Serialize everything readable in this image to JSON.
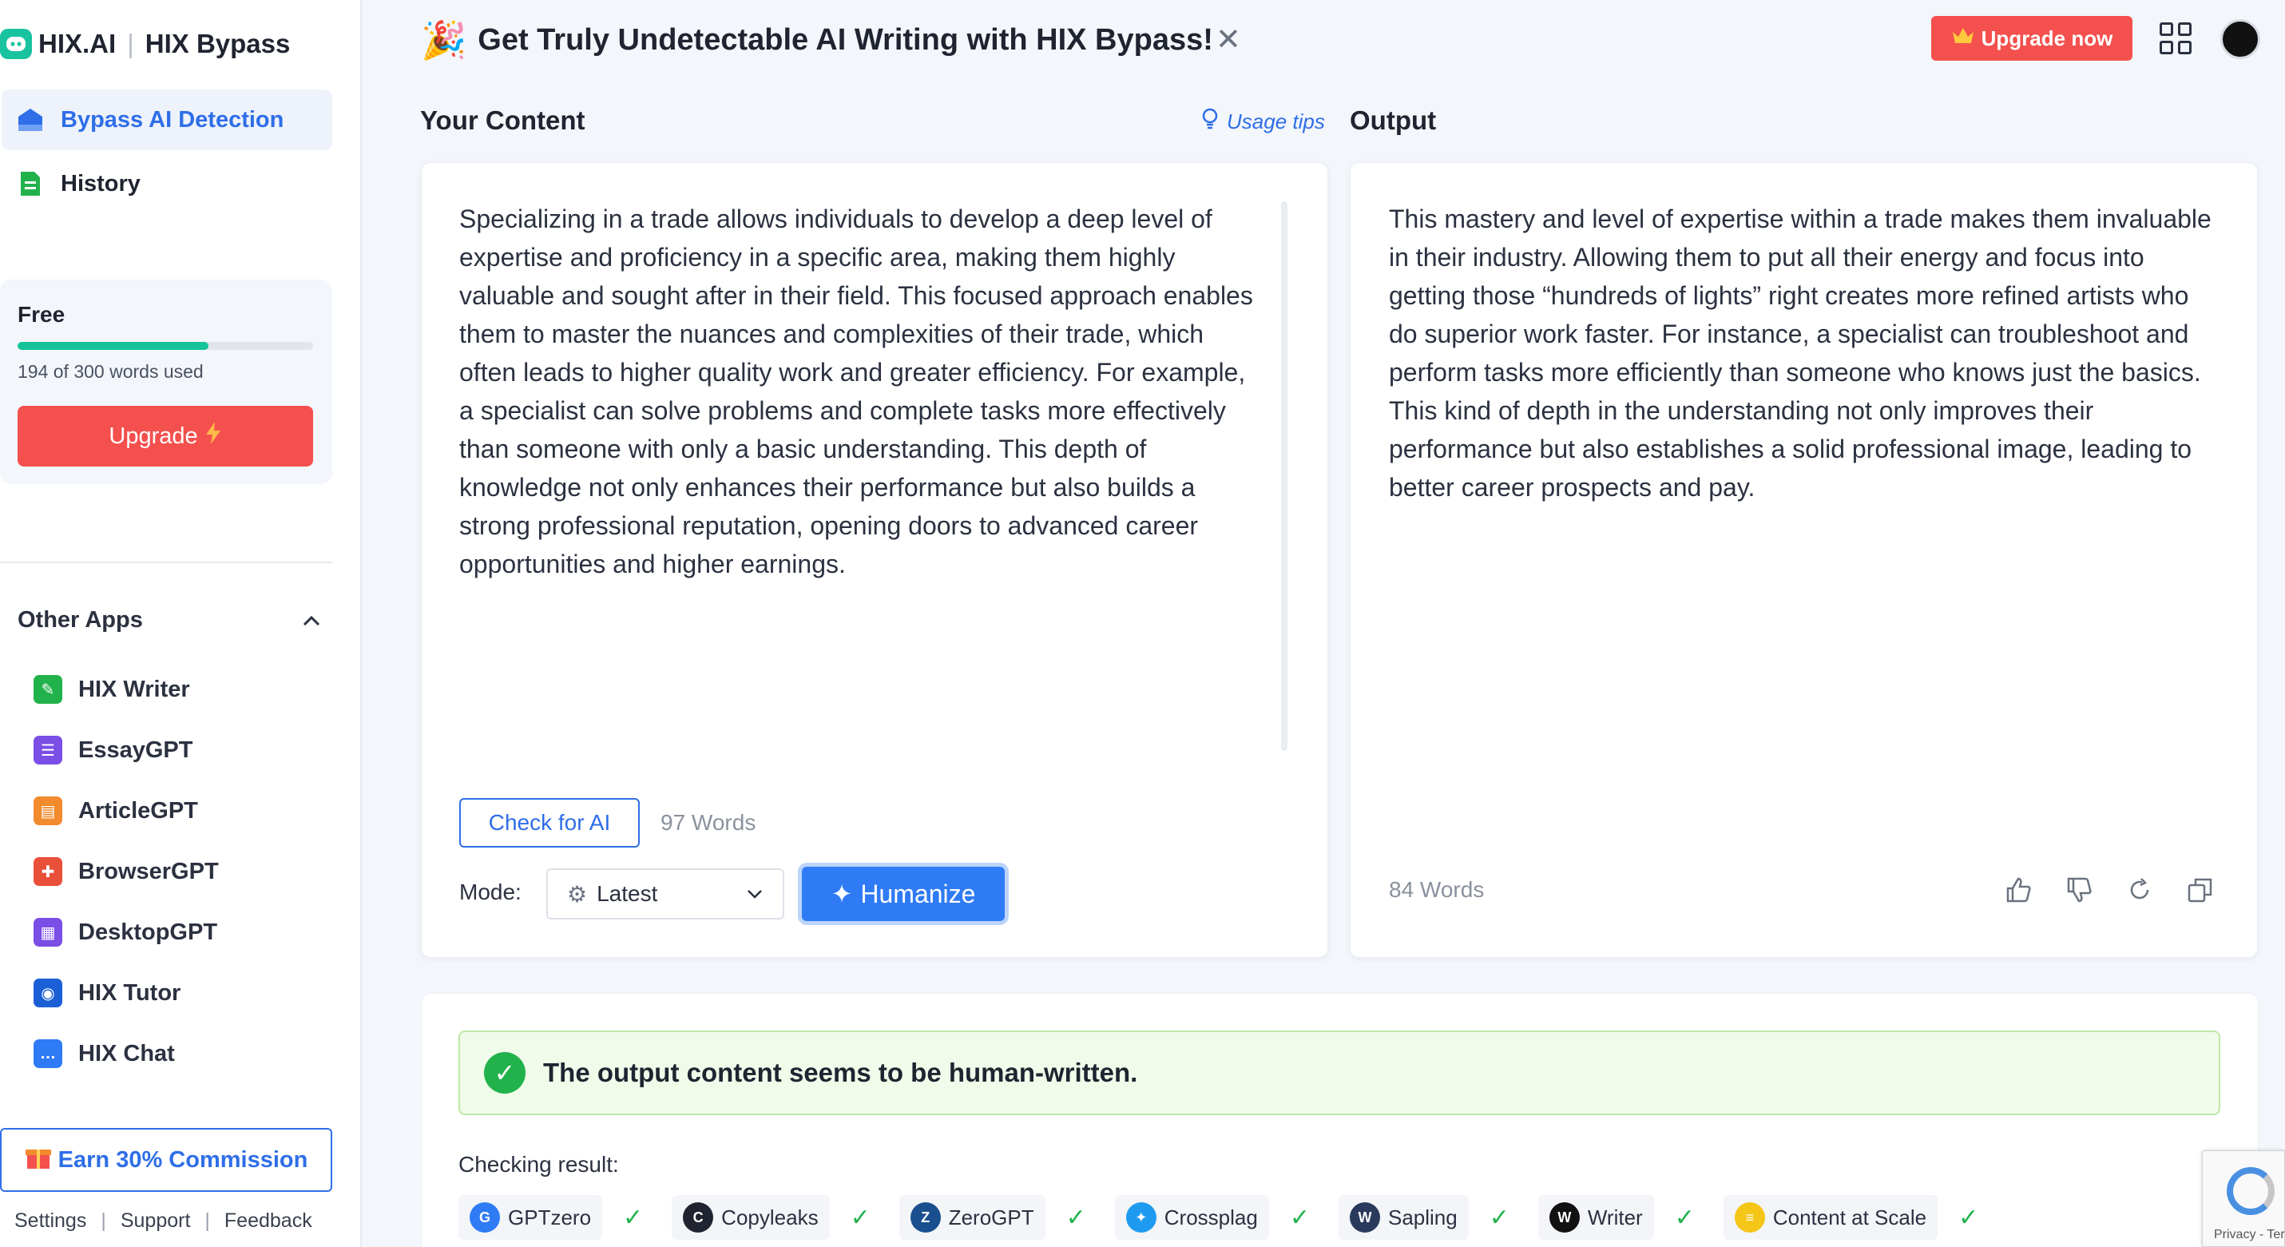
{
  "brand": {
    "name": "HIX.AI",
    "product": "HIX Bypass"
  },
  "nav": [
    {
      "label": "Bypass AI Detection",
      "icon": "home-icon",
      "active": true
    },
    {
      "label": "History",
      "icon": "document-icon",
      "active": false
    }
  ],
  "plan": {
    "name": "Free",
    "usage_text": "194 of 300 words used",
    "used_fraction": 0.647,
    "upgrade_label": "Upgrade"
  },
  "other_apps": {
    "title": "Other Apps",
    "items": [
      {
        "label": "HIX Writer",
        "color": "#22b24c",
        "icon": "pen-icon"
      },
      {
        "label": "EssayGPT",
        "color": "#7b4ee6",
        "icon": "essay-icon"
      },
      {
        "label": "ArticleGPT",
        "color": "#f28a2e",
        "icon": "article-icon"
      },
      {
        "label": "BrowserGPT",
        "color": "#e8503a",
        "icon": "puzzle-icon"
      },
      {
        "label": "DesktopGPT",
        "color": "#7b4ee6",
        "icon": "desktop-icon"
      },
      {
        "label": "HIX Tutor",
        "color": "#1a5fd6",
        "icon": "owl-icon"
      },
      {
        "label": "HIX Chat",
        "color": "#2f7bf5",
        "icon": "chat-icon"
      }
    ]
  },
  "earn_label": "Earn 30% Commission",
  "footer": {
    "settings": "Settings",
    "support": "Support",
    "feedback": "Feedback"
  },
  "banner": {
    "text": "Get Truly Undetectable AI Writing with HIX Bypass!",
    "close": "✕"
  },
  "header": {
    "upgrade_now": "Upgrade now"
  },
  "input": {
    "title": "Your Content",
    "usage_tips": "Usage tips",
    "text": "Specializing in a trade allows individuals to develop a deep level of expertise and proficiency in a specific area, making them highly valuable and sought after in their field. This focused approach enables them to master the nuances and complexities of their trade, which often leads to higher quality work and greater efficiency. For example, a specialist can solve problems and complete tasks more effectively than someone with only a basic understanding. This depth of knowledge not only enhances their performance but also builds a strong professional reputation, opening doors to advanced career opportunities and higher earnings.",
    "check_label": "Check for AI",
    "word_count": "97 Words",
    "mode_label": "Mode:",
    "mode_value": "Latest",
    "humanize_label": "Humanize"
  },
  "output": {
    "title": "Output",
    "text": "This mastery and level of expertise within a trade makes them invaluable in their industry. Allowing them to put all their energy and focus into getting those “hundreds of lights” right creates more refined artists who do superior work faster. For instance, a specialist can troubleshoot and perform tasks more efficiently than someone who knows just the basics. This kind of depth in the understanding not only improves their performance but also establishes a solid professional image, leading to better career prospects and pay.",
    "word_count": "84 Words"
  },
  "result": {
    "message": "The output content seems to be human-written.",
    "checking_label": "Checking result:",
    "detectors": [
      {
        "name": "GPTzero",
        "color": "#2f7bf5",
        "glyph": "G"
      },
      {
        "name": "Copyleaks",
        "color": "#1f2430",
        "glyph": "C"
      },
      {
        "name": "ZeroGPT",
        "color": "#1a4f8f",
        "glyph": "Z"
      },
      {
        "name": "Crossplag",
        "color": "#1e9bf0",
        "glyph": "✦"
      },
      {
        "name": "Sapling",
        "color": "#2a3a5c",
        "glyph": "W"
      },
      {
        "name": "Writer",
        "color": "#111111",
        "glyph": "W"
      },
      {
        "name": "Content at Scale",
        "color": "#f5c518",
        "glyph": "≡"
      }
    ]
  },
  "recaptcha": {
    "text": "Privacy - Ter"
  }
}
